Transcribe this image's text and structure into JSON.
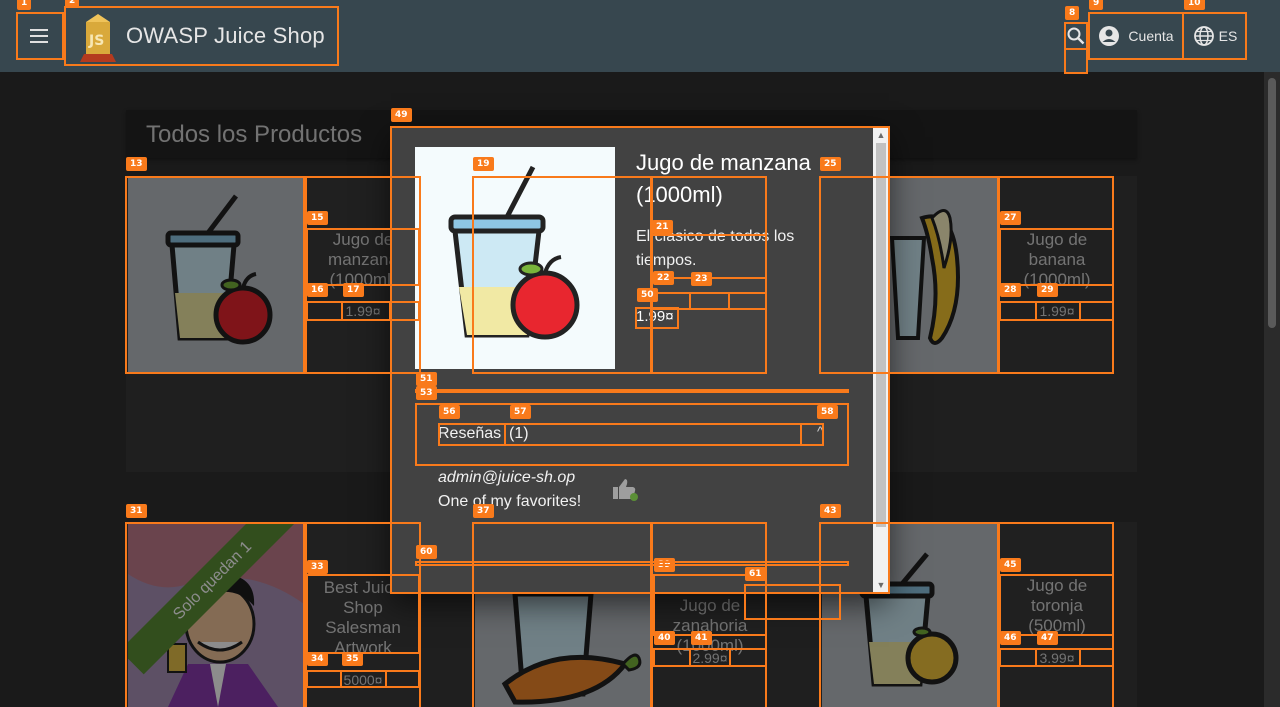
{
  "app": {
    "title": "OWASP Juice Shop",
    "account_label": "Cuenta",
    "lang_label": "ES"
  },
  "main": {
    "heading": "Todos los Productos",
    "products_row1": [
      {
        "name": "Jugo de manzana (1000ml)",
        "price": "1.99¤"
      },
      {
        "name": "Jugo de banana (1000ml)",
        "price": "1.99¤"
      }
    ],
    "products_row2": [
      {
        "name": "Best Juice Shop Salesman Artwork",
        "price": "5000¤",
        "ribbon": "Solo quedan 1"
      },
      {
        "name": "Jugo de zanahoria (1000ml)",
        "price": "2.99¤"
      },
      {
        "name": "Jugo de toronja (500ml)",
        "price": "3.99¤"
      }
    ]
  },
  "dialog": {
    "title": "Jugo de manzana (1000ml)",
    "description": "El clásico de todos los tiempos.",
    "price": "1.99¤",
    "reviews_label": "Reseñas",
    "reviews_count": "(1)",
    "review": {
      "author": "admin@juice-sh.op",
      "text": "One of my favorites!"
    }
  },
  "annotations": [
    "1",
    "2",
    "8",
    "9",
    "10",
    "13",
    "15",
    "16",
    "17",
    "19",
    "21",
    "22",
    "23",
    "25",
    "27",
    "28",
    "29",
    "31",
    "33",
    "34",
    "35",
    "37",
    "39",
    "40",
    "41",
    "43",
    "45",
    "46",
    "47",
    "49",
    "50",
    "51",
    "53",
    "56",
    "57",
    "58",
    "60",
    "61"
  ],
  "colors": {
    "toolbar": "#37474f",
    "background": "#303030",
    "annotation": "#f97a1b",
    "ribbon": "#5b8f36"
  }
}
